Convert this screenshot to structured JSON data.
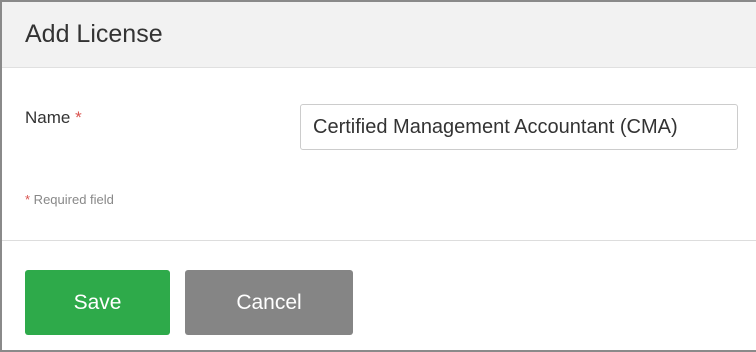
{
  "dialog": {
    "title": "Add License"
  },
  "form": {
    "name_label": "Name",
    "required_marker": "*",
    "name_value": "Certified Management Accountant (CMA)",
    "required_note_marker": "*",
    "required_note_text": " Required field"
  },
  "buttons": {
    "save_label": "Save",
    "cancel_label": "Cancel"
  },
  "colors": {
    "save_button": "#2eaa4a",
    "cancel_button": "#858585",
    "required_marker": "#d9534f",
    "header_background": "#f2f2f2"
  }
}
